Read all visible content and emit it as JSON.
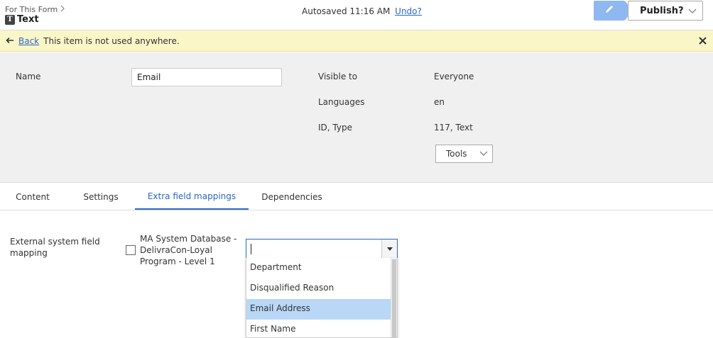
{
  "header": {
    "breadcrumb": "For This Form",
    "title": "Text",
    "title_icon_letter": "T",
    "autosave_text": "Autosaved 11:16 AM",
    "undo_label": "Undo?",
    "publish_label": "Publish?"
  },
  "notice": {
    "back_label": "Back",
    "message": "This item is not used anywhere."
  },
  "props": {
    "name_label": "Name",
    "name_value": "Email",
    "visible_label": "Visible to",
    "visible_value": "Everyone",
    "languages_label": "Languages",
    "languages_value": "en",
    "id_type_label": "ID, Type",
    "id_type_value": "117, Text",
    "tools_label": "Tools"
  },
  "tabs": [
    {
      "label": "Content"
    },
    {
      "label": "Settings"
    },
    {
      "label": "Extra field mappings",
      "active": true
    },
    {
      "label": "Dependencies"
    }
  ],
  "mapping": {
    "field_label": "External system field mapping",
    "system_label": "MA System Database - DelivraCon-Loyal Program - Level 1",
    "input_value": "",
    "options": [
      {
        "label": "Department"
      },
      {
        "label": "Disqualified Reason"
      },
      {
        "label": "Email Address",
        "selected": true
      },
      {
        "label": "First Name"
      }
    ]
  },
  "colors": {
    "accent": "#2a66c9",
    "notice_bg": "#fbf6c8",
    "panel_bg": "#f0f0f0",
    "selected_option": "#b9d7f7",
    "edit_button": "#8fb8f0"
  },
  "icons": {
    "breadcrumb": "chevron-right-icon",
    "edit": "pencil-icon",
    "publish_dropdown": "chevron-down-icon",
    "back": "arrow-left-icon",
    "close": "close-icon",
    "tools_dropdown": "chevron-down-icon",
    "combo_dropdown": "triangle-down-icon"
  }
}
